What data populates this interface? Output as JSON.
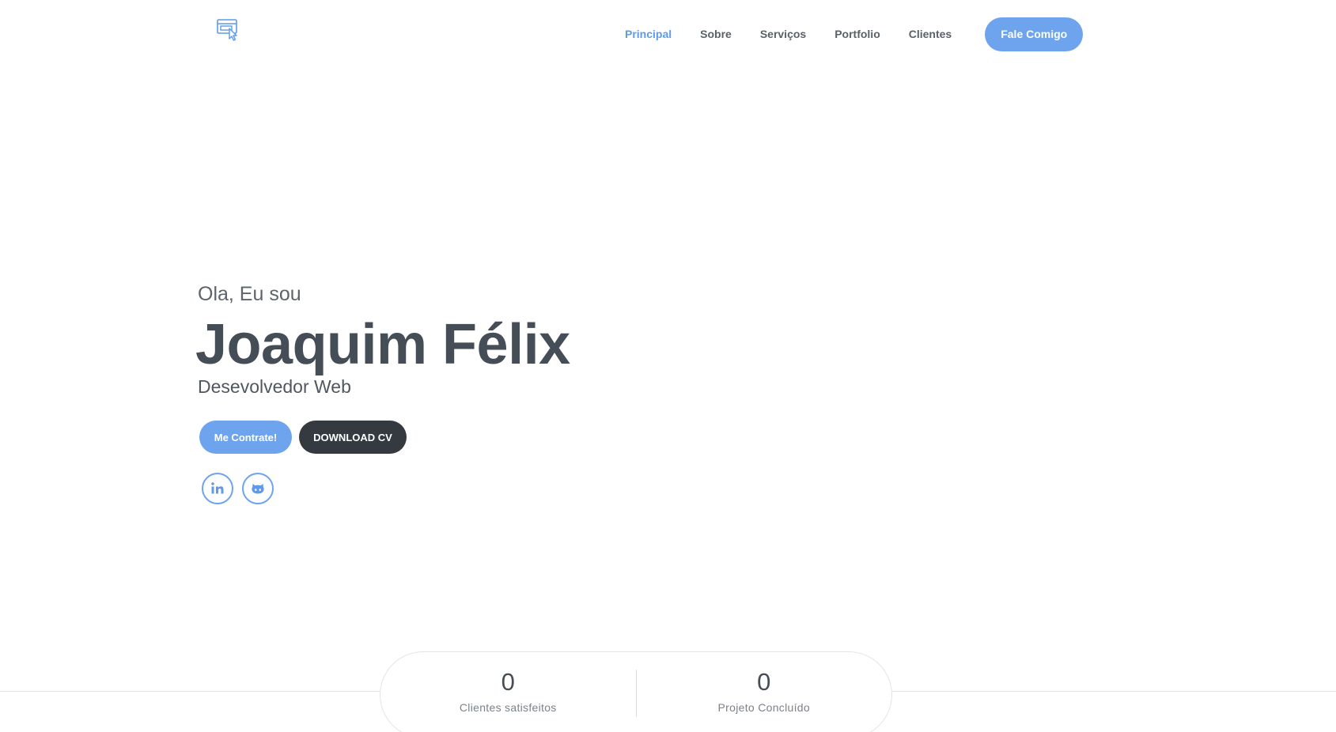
{
  "header": {
    "logo_icon": "browser-cursor-icon",
    "nav": [
      {
        "label": "Principal",
        "active": true
      },
      {
        "label": "Sobre",
        "active": false
      },
      {
        "label": "Serviços",
        "active": false
      },
      {
        "label": "Portfolio",
        "active": false
      },
      {
        "label": "Clientes",
        "active": false
      }
    ],
    "cta_label": "Fale Comigo"
  },
  "hero": {
    "greeting": "Ola, Eu sou",
    "name": "Joaquim Félix",
    "role": "Desevolvedor Web",
    "primary_button": "Me Contrate!",
    "secondary_button": "DOWNLOAD CV",
    "social": [
      {
        "icon": "linkedin-icon"
      },
      {
        "icon": "github-icon"
      }
    ]
  },
  "stats": [
    {
      "number": "0",
      "label": "Clientes satisfeitos"
    },
    {
      "number": "0",
      "label": "Projeto Concluído"
    }
  ],
  "colors": {
    "accent": "#6ea4ee",
    "accent_text": "#5e9ae9",
    "dark": "#343a40",
    "text": "#454d57"
  }
}
